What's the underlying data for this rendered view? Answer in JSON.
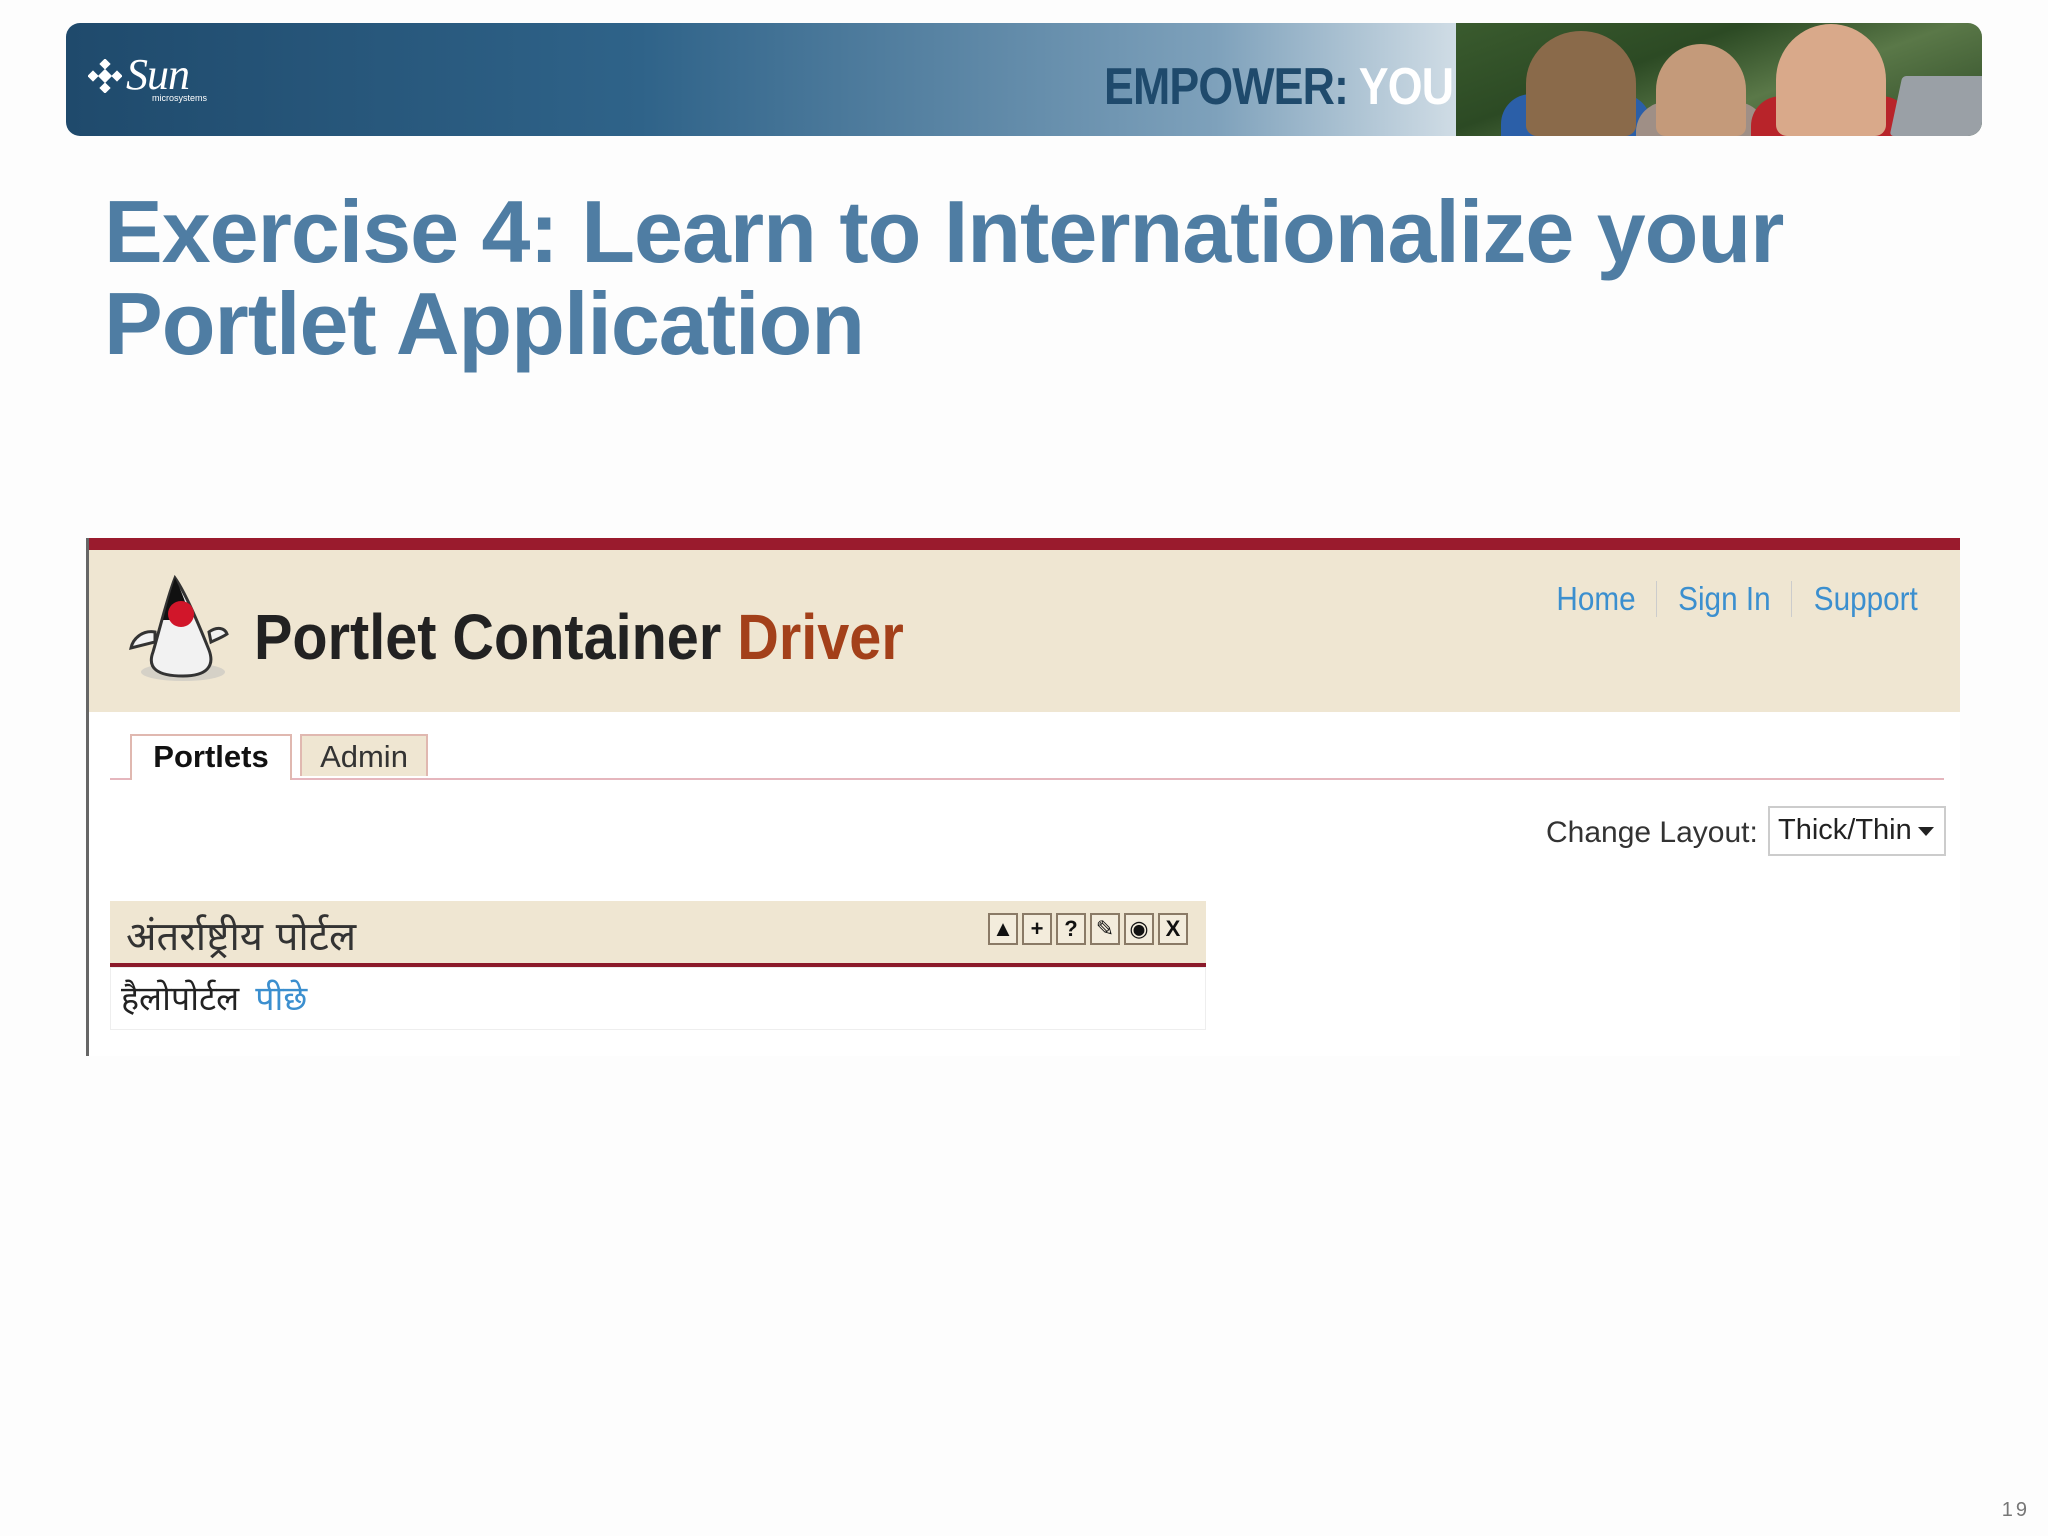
{
  "banner": {
    "logo_text": "Sun",
    "logo_subtext": "microsystems",
    "tagline_part1": "EMPOWER:",
    "tagline_part2": "YOU"
  },
  "slide": {
    "title": "Exercise 4: Learn to Internationalize your Portlet Application",
    "page_number": "19"
  },
  "app": {
    "title_main": "Portlet Container",
    "title_accent": "Driver",
    "top_links": [
      "Home",
      "Sign In",
      "Support"
    ],
    "tabs": [
      {
        "label": "Portlets",
        "active": true
      },
      {
        "label": "Admin",
        "active": false
      }
    ],
    "layout": {
      "label": "Change Layout:",
      "selected": "Thick/Thin"
    },
    "portlet": {
      "title": "अंतर्राष्ट्रीय पोर्टल",
      "controls": [
        "minimize-icon",
        "maximize-icon",
        "help-icon",
        "edit-icon",
        "view-icon",
        "close-icon"
      ],
      "control_glyphs": [
        "▲",
        "+",
        "?",
        "✎",
        "◉",
        "X"
      ],
      "body_text": "हैलोपोर्टल",
      "body_link": "पीछे"
    },
    "colors": {
      "accent_red": "#9a1b2d",
      "header_bg": "#efe6d2",
      "link_blue": "#3b8fcf",
      "title_accent": "#a3401a"
    }
  }
}
